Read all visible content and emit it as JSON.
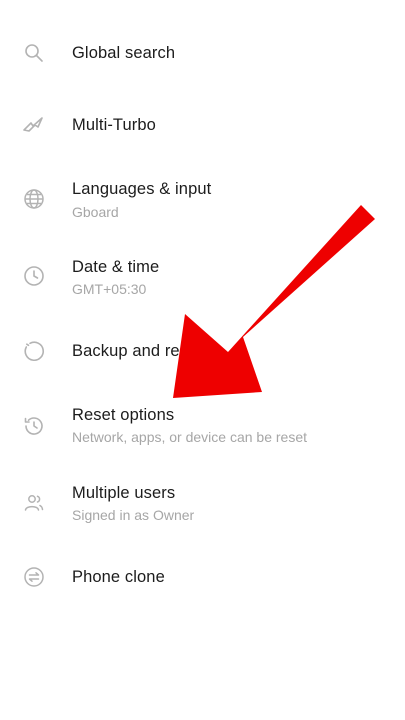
{
  "settings": {
    "items": [
      {
        "label": "Global search",
        "subtitle": "",
        "icon": "search-icon"
      },
      {
        "label": "Multi-Turbo",
        "subtitle": "",
        "icon": "turbo-icon"
      },
      {
        "label": "Languages & input",
        "subtitle": "Gboard",
        "icon": "globe-icon"
      },
      {
        "label": "Date & time",
        "subtitle": "GMT+05:30",
        "icon": "clock-icon"
      },
      {
        "label": "Backup and re",
        "subtitle": "",
        "icon": "backup-icon"
      },
      {
        "label": "Reset options",
        "subtitle": "Network, apps, or device can be reset",
        "icon": "reset-history-icon"
      },
      {
        "label": "Multiple users",
        "subtitle": "Signed in as Owner",
        "icon": "users-icon"
      },
      {
        "label": "Phone clone",
        "subtitle": "",
        "icon": "phone-clone-icon"
      }
    ]
  },
  "colors": {
    "icon": "#b3b3b3",
    "title": "#1c1c1c",
    "subtitle": "#a6a6a6",
    "arrow": "#ee0000"
  }
}
